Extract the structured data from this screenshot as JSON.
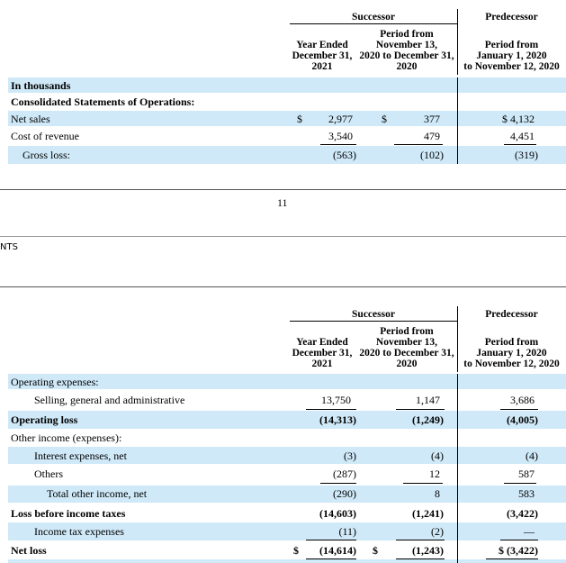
{
  "page_number": "11",
  "header_fragment": "NTS",
  "columns": {
    "successor": "Successor",
    "predecessor": "Predecessor",
    "col1": [
      "Year Ended",
      "December 31,",
      "2021"
    ],
    "col2": [
      "Period from",
      "November 13,",
      "2020 to December 31,",
      "2020"
    ],
    "col3": [
      "Period from",
      "January 1, 2020",
      "to November 12, 2020"
    ]
  },
  "top_table": {
    "in_thousands": "In thousands",
    "section": "Consolidated Statements of Operations:",
    "rows": [
      {
        "label": "Net sales",
        "d1": "$",
        "v1": "2,977",
        "d2": "$",
        "v2": "377",
        "v3": "$  4,132"
      },
      {
        "label": "Cost of revenue",
        "d1": "",
        "v1": "3,540",
        "d2": "",
        "v2": "479",
        "v3": "4,451"
      },
      {
        "label": "Gross loss:",
        "d1": "",
        "v1": "(563)",
        "d2": "",
        "v2": "(102)",
        "v3": "(319)"
      }
    ]
  },
  "bottom_table": {
    "rows": [
      {
        "label": "Operating expenses:",
        "v1": "",
        "v2": "",
        "v3": ""
      },
      {
        "label": "Selling, general and administrative",
        "v1": "13,750",
        "v2": "1,147",
        "v3": "3,686"
      },
      {
        "label": "Operating loss",
        "v1": "(14,313)",
        "v2": "(1,249)",
        "v3": "(4,005)"
      },
      {
        "label": "Other income (expenses):",
        "v1": "",
        "v2": "",
        "v3": ""
      },
      {
        "label": "Interest expenses, net",
        "v1": "(3)",
        "v2": "(4)",
        "v3": "(4)"
      },
      {
        "label": "Others",
        "v1": "(287)",
        "v2": "12",
        "v3": "587"
      },
      {
        "label": "Total other income, net",
        "v1": "(290)",
        "v2": "8",
        "v3": "583"
      },
      {
        "label": "Loss before income taxes",
        "v1": "(14,603)",
        "v2": "(1,241)",
        "v3": "(3,422)"
      },
      {
        "label": "Income tax expenses",
        "v1": "(11)",
        "v2": "(2)",
        "v3": "—"
      },
      {
        "label": "Net loss",
        "d1": "$",
        "v1": "(14,614)",
        "d2": "$",
        "v2": "(1,243)",
        "v3": "$  (3,422)"
      }
    ]
  }
}
